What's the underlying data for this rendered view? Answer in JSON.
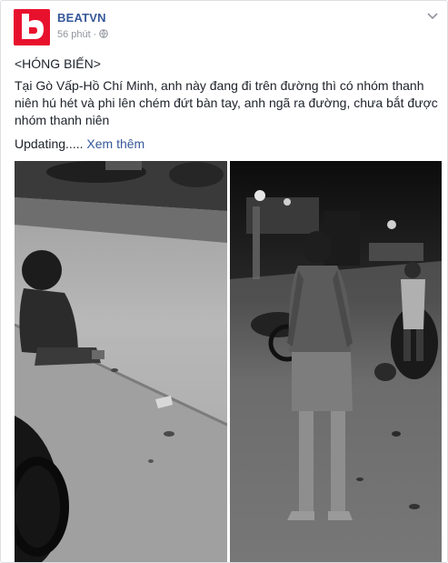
{
  "post": {
    "page_name": "BEATVN",
    "time": "56 phút",
    "dot": "·",
    "tag": "<HÓNG BIẾN>",
    "body": "Tại Gò Vấp-Hồ Chí Minh, anh này đang đi trên đường thì có nhóm thanh niên hú hét và phi lên chém đứt bàn tay, anh ngã ra đường, chưa bắt được nhóm thanh niên",
    "updating": "Updating.....",
    "see_more": "Xem thêm"
  },
  "icons": {
    "avatar": "beatvn-logo",
    "privacy": "globe-icon",
    "menu": "chevron-down-icon"
  },
  "colors": {
    "brand": "#e8112d",
    "link": "#365899",
    "meta": "#90949c",
    "text": "#1d2129"
  }
}
